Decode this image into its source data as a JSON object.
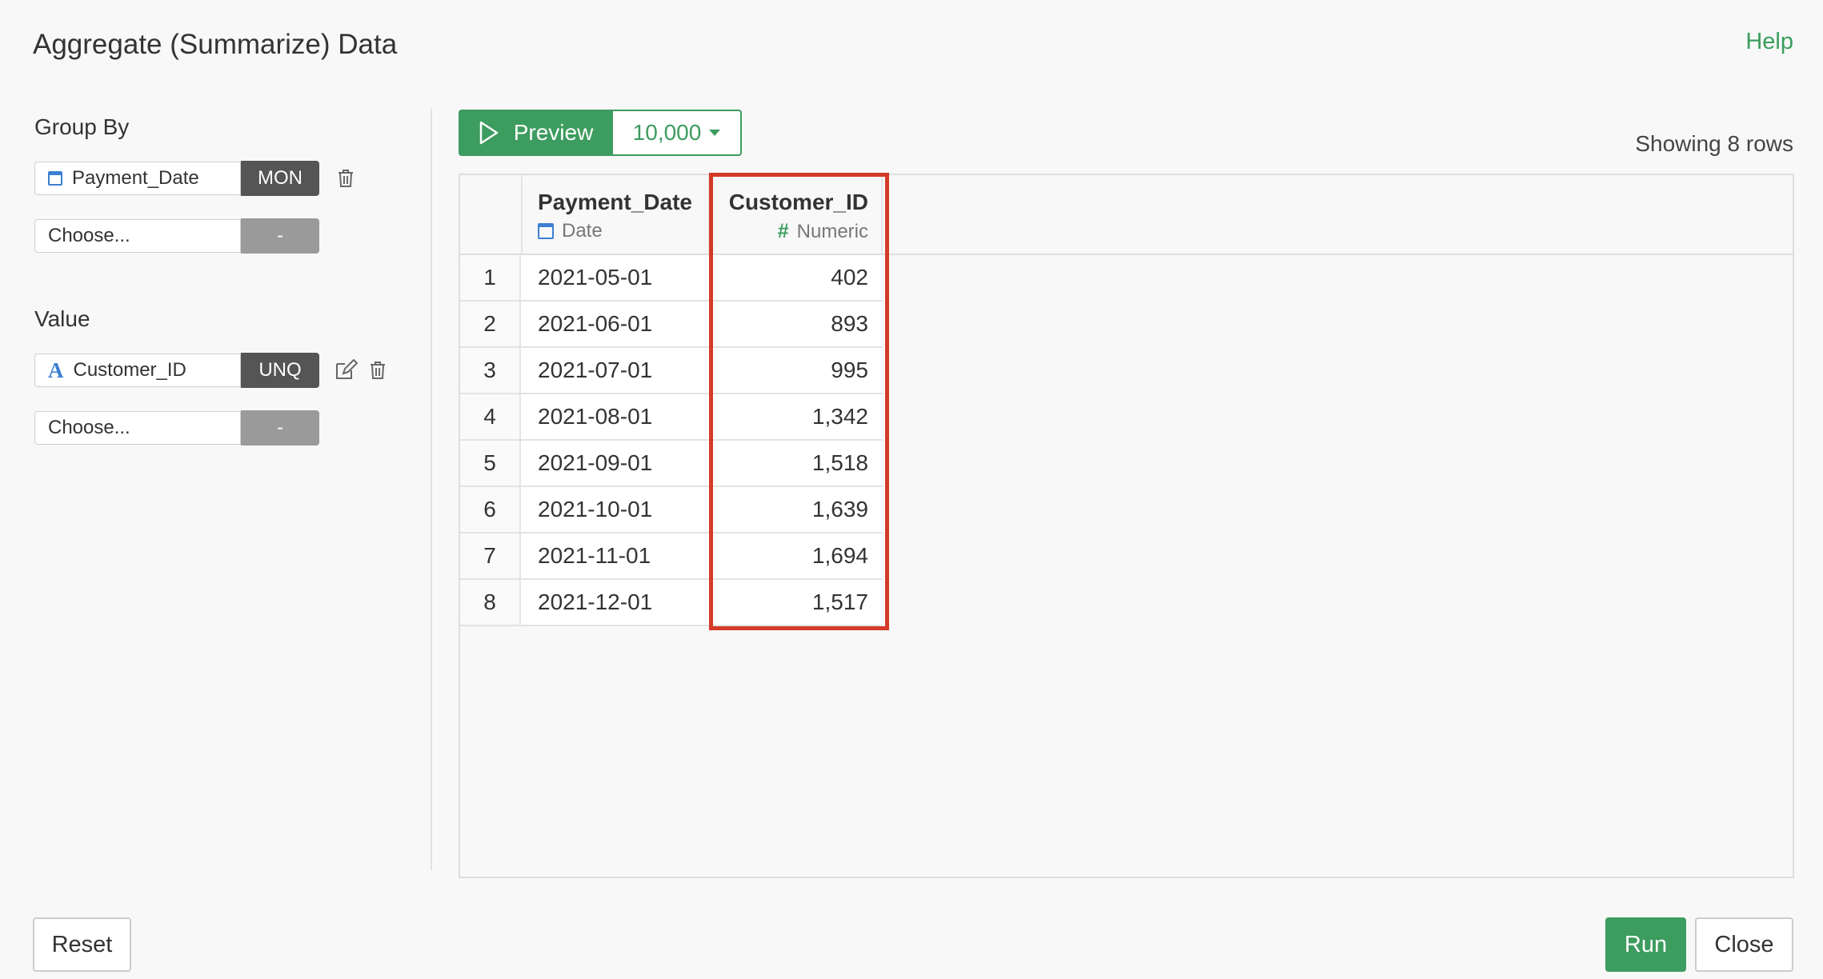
{
  "dialog": {
    "title": "Aggregate (Summarize) Data",
    "help_label": "Help"
  },
  "group_by": {
    "label": "Group By",
    "fields": [
      {
        "name": "Payment_Date",
        "tag": "MON",
        "icon": "calendar-icon"
      },
      {
        "name": "Choose...",
        "tag": "-"
      }
    ]
  },
  "value": {
    "label": "Value",
    "fields": [
      {
        "name": "Customer_ID",
        "tag": "UNQ",
        "icon": "string-type-icon"
      },
      {
        "name": "Choose...",
        "tag": "-"
      }
    ]
  },
  "toolbar": {
    "preview_label": "Preview",
    "rows_label": "10,000",
    "showing": "Showing 8 rows"
  },
  "table": {
    "columns": [
      {
        "name": "Payment_Date",
        "type": "Date",
        "icon": "calendar-icon"
      },
      {
        "name": "Customer_ID",
        "type": "Numeric",
        "icon": "numeric-hash-icon"
      }
    ],
    "rows": [
      {
        "idx": "1",
        "date": "2021-05-01",
        "value": "402"
      },
      {
        "idx": "2",
        "date": "2021-06-01",
        "value": "893"
      },
      {
        "idx": "3",
        "date": "2021-07-01",
        "value": "995"
      },
      {
        "idx": "4",
        "date": "2021-08-01",
        "value": "1,342"
      },
      {
        "idx": "5",
        "date": "2021-09-01",
        "value": "1,518"
      },
      {
        "idx": "6",
        "date": "2021-10-01",
        "value": "1,639"
      },
      {
        "idx": "7",
        "date": "2021-11-01",
        "value": "1,694"
      },
      {
        "idx": "8",
        "date": "2021-12-01",
        "value": "1,517"
      }
    ]
  },
  "footer": {
    "reset_label": "Reset",
    "run_label": "Run",
    "close_label": "Close"
  },
  "colors": {
    "accent": "#3d9c5f",
    "highlight": "#d43a27",
    "dark_tag": "#555555"
  }
}
